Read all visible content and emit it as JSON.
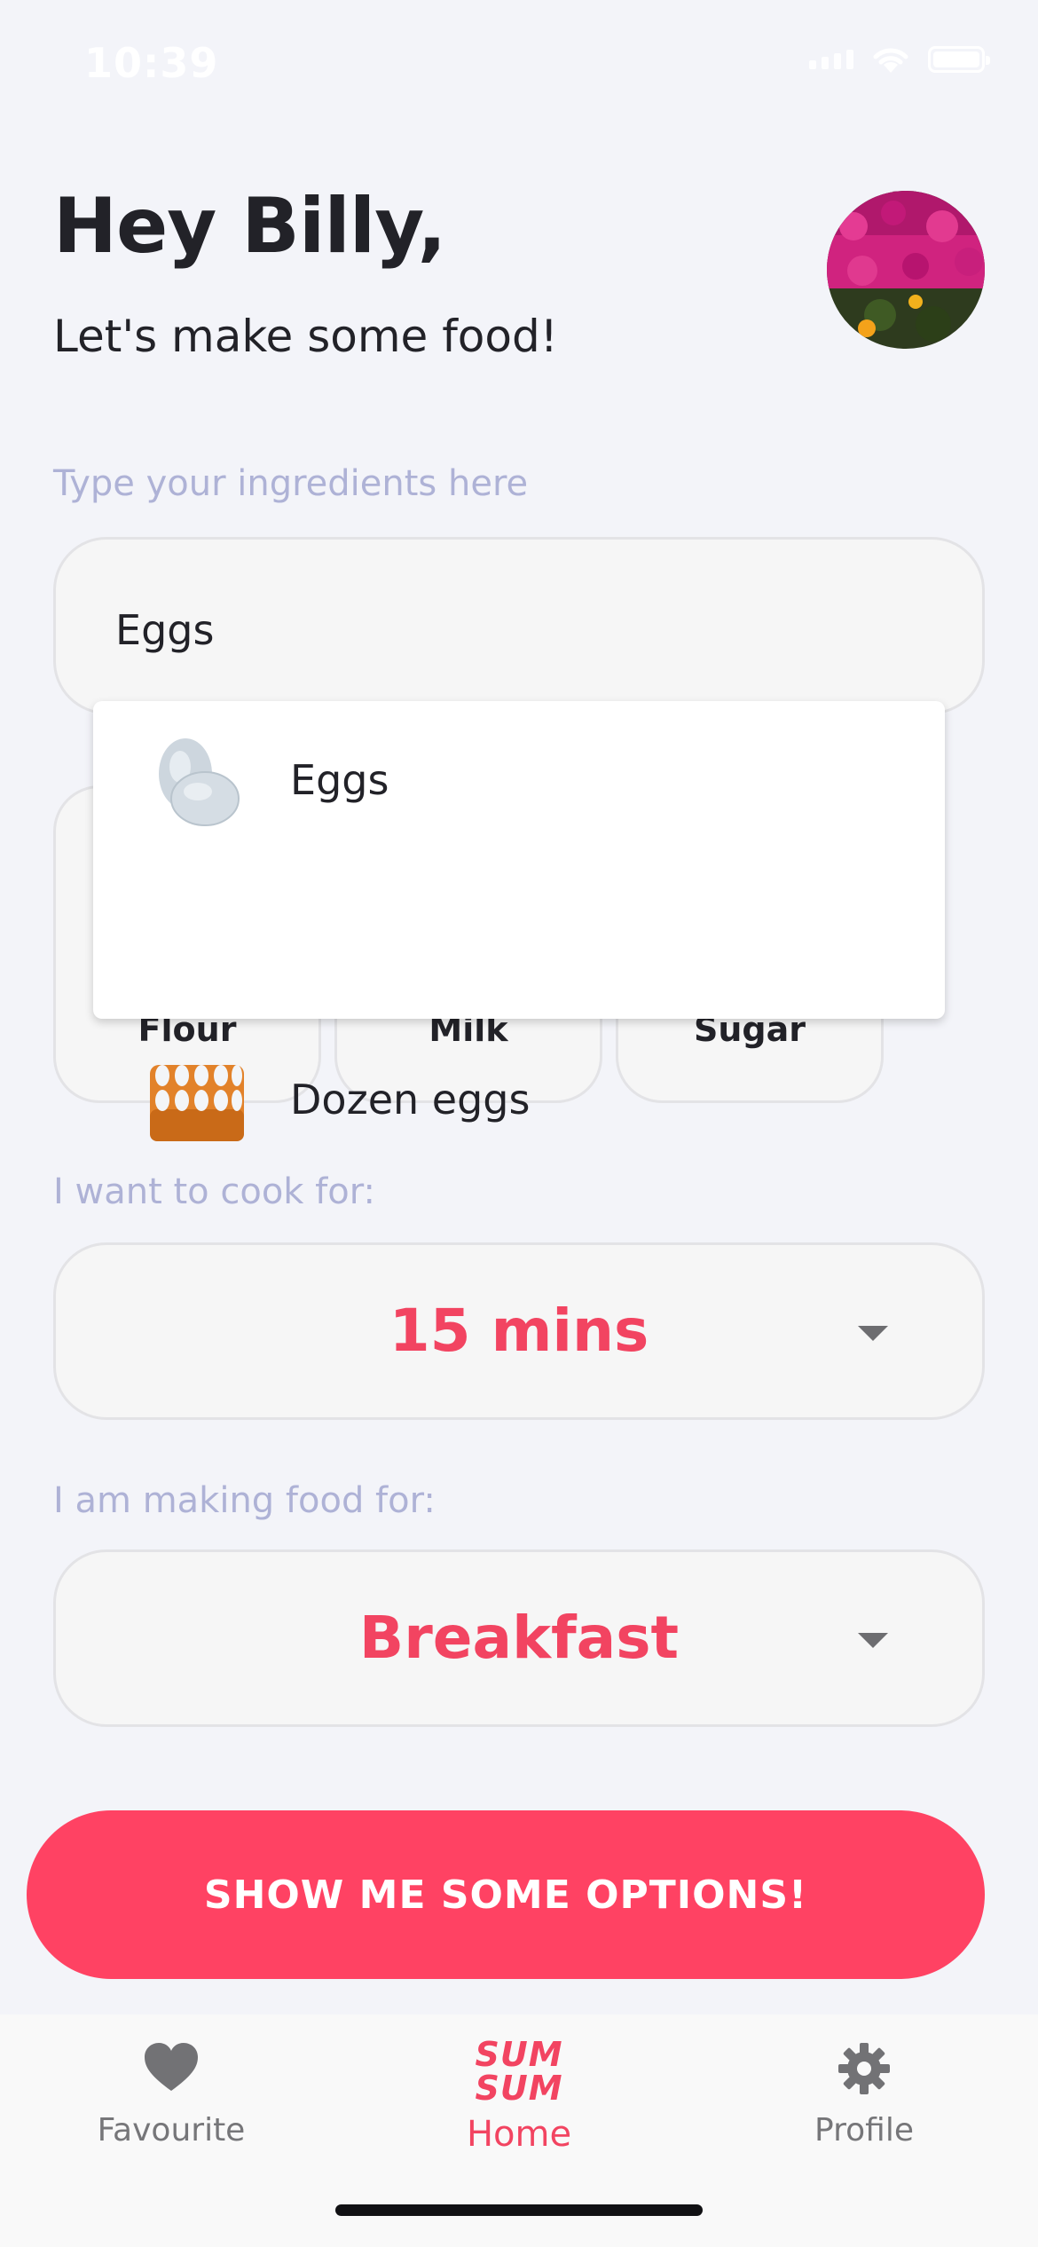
{
  "status_bar": {
    "time": "10:39"
  },
  "header": {
    "greeting": "Hey Billy,",
    "subtitle": "Let's make some food!"
  },
  "ingredients": {
    "label": "Type your ingredients here",
    "input_value": "Eggs",
    "suggestions": [
      {
        "label": "Eggs",
        "icon": "eggs-icon"
      },
      {
        "label": "Dozen eggs",
        "icon": "egg-carton-icon"
      }
    ],
    "chips": [
      {
        "label": "Flour"
      },
      {
        "label": "Milk"
      },
      {
        "label": "Sugar"
      }
    ]
  },
  "cook_time": {
    "label": "I want to cook for:",
    "value": "15 mins"
  },
  "meal": {
    "label": "I am making food for:",
    "value": "Breakfast"
  },
  "cta": {
    "label": "SHOW ME SOME OPTIONS!"
  },
  "tabbar": {
    "brand_top": "SUM",
    "brand_bottom": "SUM",
    "tabs": [
      {
        "label": "Favourite",
        "icon": "heart-icon"
      },
      {
        "label": "Home",
        "icon": "sumsum-logo"
      },
      {
        "label": "Profile",
        "icon": "gear-icon"
      }
    ]
  },
  "colors": {
    "accent": "#ff4263",
    "accent_text": "#f24461",
    "label": "#aeb2d6",
    "background": "#f3f4f9"
  }
}
